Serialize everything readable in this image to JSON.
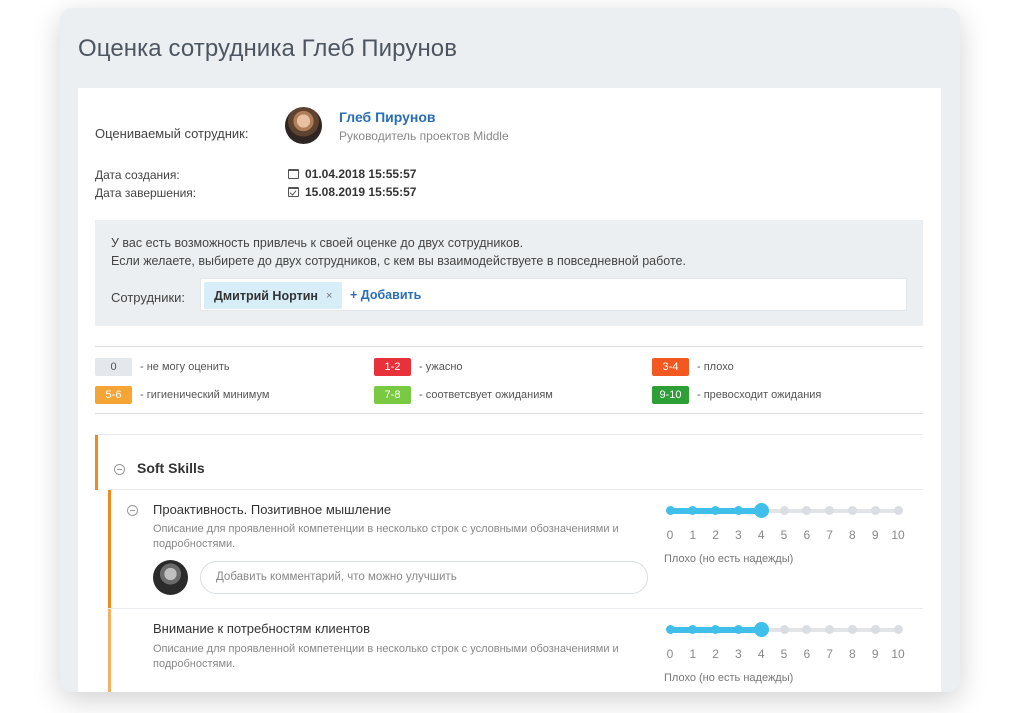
{
  "page": {
    "title": "Оценка сотрудника Глеб Пирунов"
  },
  "employee": {
    "label": "Оцениваемый сотрудник:",
    "name": "Глеб Пирунов",
    "role": "Руководитель проектов Middle"
  },
  "dates": {
    "created_label": "Дата создания:",
    "created_value": "01.04.2018 15:55:57",
    "completed_label": "Дата завершения:",
    "completed_value": "15.08.2019 15:55:57"
  },
  "invite": {
    "line1": "У вас есть возможность привлечь к своей оценке до двух сотрудников.",
    "line2": "Если желаете, выбирете до двух сотрудников, с кем вы взаимодействуете в повседневной работе.",
    "employees_label": "Сотрудники:",
    "selected": [
      {
        "name": "Дмитрий Нортин",
        "remove": "×"
      }
    ],
    "add_label": "+ Добавить"
  },
  "legend": [
    {
      "range": "0",
      "text": "- не могу оценить",
      "color": "#e4e7eb",
      "text_color": "#555555"
    },
    {
      "range": "1-2",
      "text": "- ужасно",
      "color": "#e8323a",
      "text_color": "#ffffff"
    },
    {
      "range": "3-4",
      "text": "- плохо",
      "color": "#f2581f",
      "text_color": "#ffffff"
    },
    {
      "range": "5-6",
      "text": "- гигиенический минимум",
      "color": "#f5a534",
      "text_color": "#ffffff"
    },
    {
      "range": "7-8",
      "text": "- соответсвует ожиданиям",
      "color": "#7ac943",
      "text_color": "#ffffff"
    },
    {
      "range": "9-10",
      "text": "- превосходит ожидания",
      "color": "#2e9e37",
      "text_color": "#ffffff"
    }
  ],
  "section": {
    "title": "Soft Skills",
    "accent": "#f08a1c",
    "items": [
      {
        "title": "Проактивность. Позитивное мышление",
        "description": "Описание для проявленной компетенции в несколько строк с условными обозначениями и подробностями.",
        "rating": 4,
        "rating_caption": "Плохо (но есть надежды)",
        "comment_placeholder": "Добавить комментарий, что можно улучшить",
        "bar_color": "#f08a1c"
      },
      {
        "title": "Внимание к потребностям клиентов",
        "description": "Описание для проявленной компетенции в несколько строк с условными обозначениями и подробностями.",
        "rating": 4,
        "rating_caption": "Плохо (но есть надежды)",
        "bar_color": "#f5b160"
      }
    ]
  },
  "scale": {
    "ticks": [
      "0",
      "1",
      "2",
      "3",
      "4",
      "5",
      "6",
      "7",
      "8",
      "9",
      "10"
    ],
    "accent": "#3fbfe9"
  }
}
